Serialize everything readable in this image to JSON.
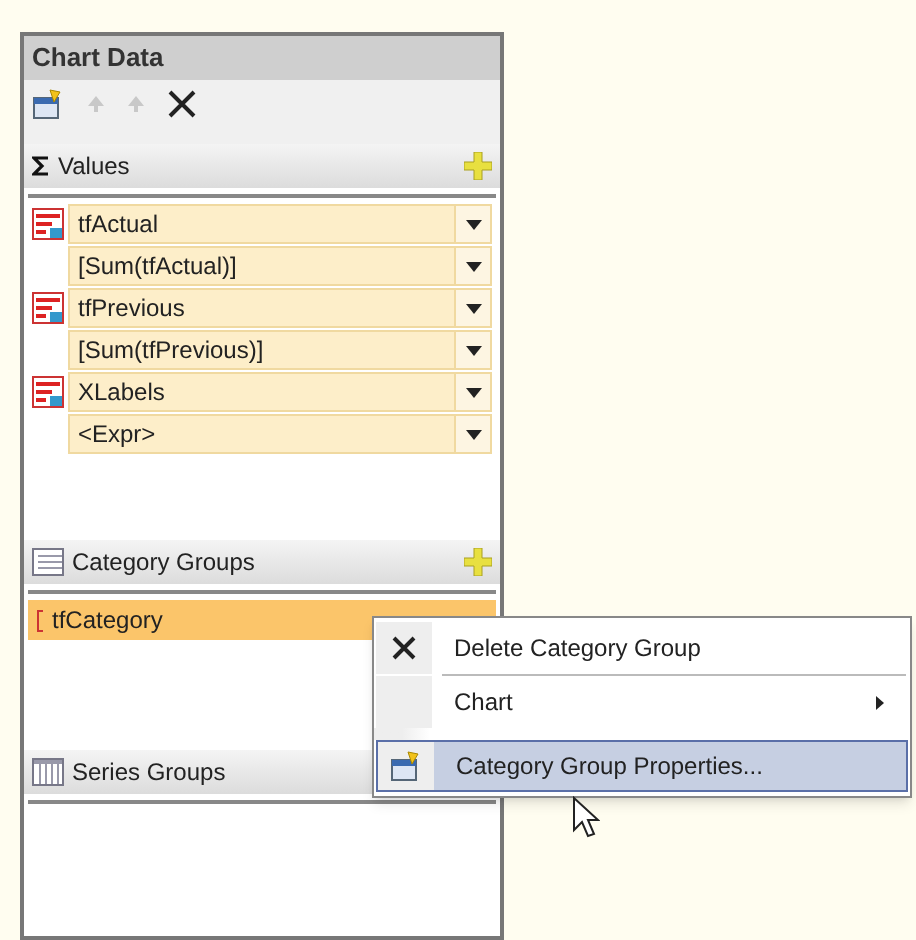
{
  "panel": {
    "title": "Chart Data"
  },
  "values": {
    "header": "Values",
    "items": [
      {
        "kind": "field",
        "label": "tfActual"
      },
      {
        "kind": "expression",
        "label": "[Sum(tfActual)]"
      },
      {
        "kind": "field",
        "label": "tfPrevious"
      },
      {
        "kind": "expression",
        "label": "[Sum(tfPrevious)]"
      },
      {
        "kind": "field",
        "label": "XLabels"
      },
      {
        "kind": "expression",
        "label": "<Expr>"
      }
    ]
  },
  "category_groups": {
    "header": "Category Groups",
    "items": [
      {
        "label": "tfCategory",
        "selected": true
      }
    ]
  },
  "series_groups": {
    "header": "Series Groups"
  },
  "context_menu": {
    "items": [
      {
        "kind": "delete",
        "label": "Delete Category Group",
        "submenu": false,
        "selected": false
      },
      {
        "kind": "plain",
        "label": "Chart",
        "submenu": true,
        "selected": false
      },
      {
        "kind": "properties",
        "label": "Category Group Properties...",
        "submenu": false,
        "selected": true
      }
    ]
  }
}
